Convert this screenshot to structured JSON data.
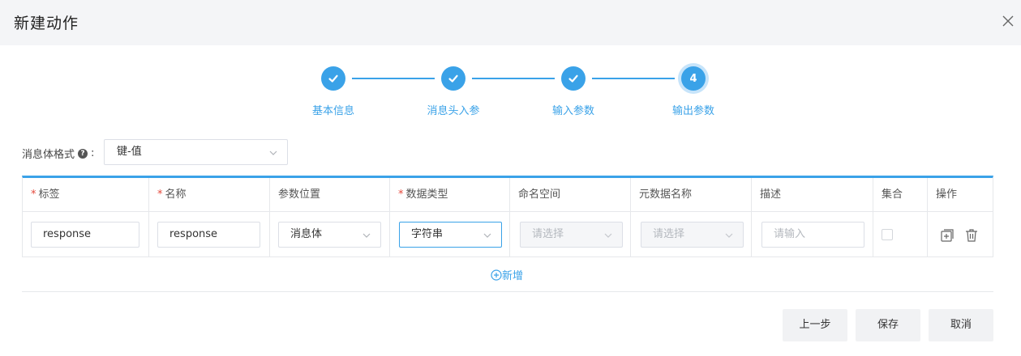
{
  "dialog": {
    "title": "新建动作"
  },
  "steps": [
    {
      "label": "基本信息",
      "state": "done"
    },
    {
      "label": "消息头入参",
      "state": "done"
    },
    {
      "label": "输入参数",
      "state": "done"
    },
    {
      "label": "输出参数",
      "state": "current",
      "number": "4"
    }
  ],
  "format": {
    "label": "消息体格式",
    "colon": ":",
    "value": "键-值"
  },
  "table": {
    "headers": [
      {
        "label": "标签",
        "required": true
      },
      {
        "label": "名称",
        "required": true
      },
      {
        "label": "参数位置",
        "required": false
      },
      {
        "label": "数据类型",
        "required": true
      },
      {
        "label": "命名空间",
        "required": false
      },
      {
        "label": "元数据名称",
        "required": false
      },
      {
        "label": "描述",
        "required": false
      },
      {
        "label": "集合",
        "required": false
      },
      {
        "label": "操作",
        "required": false
      }
    ],
    "row": {
      "tag": "response",
      "name": "response",
      "position": "消息体",
      "datatype": "字符串",
      "namespace_placeholder": "请选择",
      "metadata_placeholder": "请选择",
      "desc_placeholder": "请输入",
      "collection_checked": false
    },
    "required_mark": "*"
  },
  "add_label": "新增",
  "buttons": {
    "prev": "上一步",
    "save": "保存",
    "cancel": "取消"
  },
  "colors": {
    "accent": "#3aa2e8",
    "required": "#e5483b"
  }
}
